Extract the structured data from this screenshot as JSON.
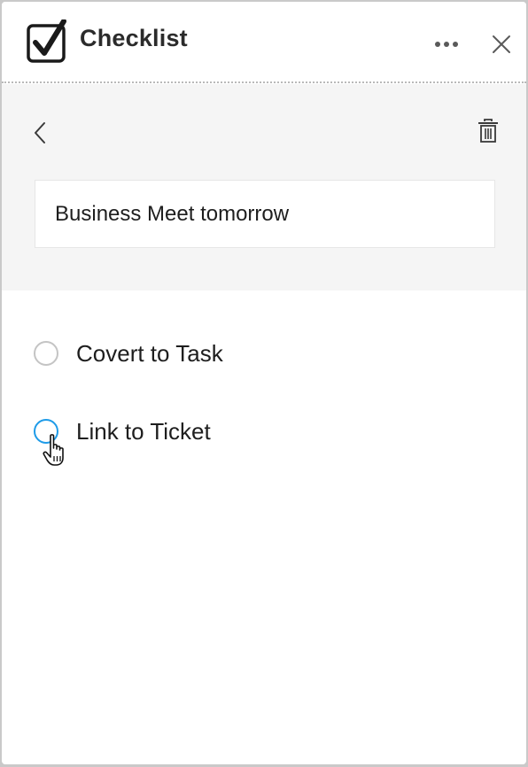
{
  "header": {
    "title": "Checklist",
    "app_icon": "checkbox-checked-icon",
    "more_icon": "more-horizontal-icon",
    "close_icon": "close-icon"
  },
  "editor": {
    "back_icon": "chevron-left-icon",
    "delete_icon": "trash-icon",
    "title_value": "Business Meet tomorrow"
  },
  "options": [
    {
      "label": "Covert to Task",
      "hovered": false
    },
    {
      "label": "Link to Ticket",
      "hovered": true
    }
  ],
  "colors": {
    "accent": "#1e9be8",
    "editor_background": "#f5f5f5",
    "radio_border": "#c4c4c4",
    "text": "#1e1e1e"
  }
}
